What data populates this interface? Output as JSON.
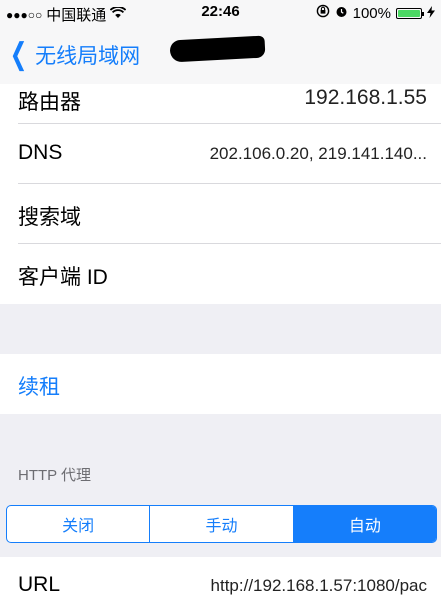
{
  "status_bar": {
    "signal": "●●●○○",
    "carrier": "中国联通",
    "time": "22:46",
    "battery_percent": "100%",
    "battery_level": 1.0
  },
  "nav": {
    "back_label": "无线局域网"
  },
  "rows": {
    "router": {
      "label": "路由器",
      "value": "192.168.1.55"
    },
    "dns": {
      "label": "DNS",
      "value": "202.106.0.20, 219.141.140..."
    },
    "search_domain": {
      "label": "搜索域",
      "value": ""
    },
    "client_id": {
      "label": "客户端 ID",
      "value": ""
    }
  },
  "renew": {
    "label": "续租"
  },
  "http_proxy": {
    "header": "HTTP 代理",
    "options": [
      "关闭",
      "手动",
      "自动"
    ],
    "selected_index": 2,
    "url_label": "URL",
    "url_value": "http://192.168.1.57:1080/pac"
  },
  "colors": {
    "accent": "#157efb",
    "background": "#efeff4",
    "battery": "#4cd964"
  }
}
